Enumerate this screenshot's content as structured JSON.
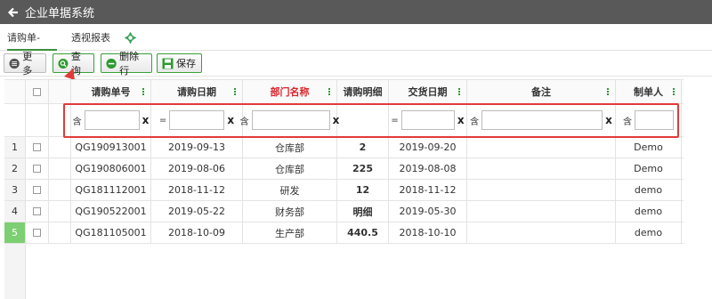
{
  "app": {
    "title": "企业单据系统"
  },
  "tabs": [
    {
      "label": "请购单-ERP"
    },
    {
      "label": "透视报表"
    }
  ],
  "toolbar": {
    "more_label": "更多",
    "query_label": "查询",
    "delete_row_label": "删除行",
    "save_label": "保存"
  },
  "grid": {
    "columns": [
      "请购单号",
      "请购日期",
      "部门名称",
      "请购明细",
      "交货日期",
      "备注",
      "制单人"
    ],
    "filters": {
      "op_contains": "含",
      "op_equals": "=",
      "clear": "x"
    },
    "rows": [
      {
        "num": "1",
        "order_no": "QG190913001",
        "request_date": "2019-09-13",
        "dept": "仓库部",
        "detail": "2",
        "delivery_date": "2019-09-20",
        "remark": "",
        "creator": "Demo"
      },
      {
        "num": "2",
        "order_no": "QG190806001",
        "request_date": "2019-08-06",
        "dept": "仓库部",
        "detail": "225",
        "delivery_date": "2019-08-08",
        "remark": "",
        "creator": "Demo"
      },
      {
        "num": "3",
        "order_no": "QG181112001",
        "request_date": "2018-11-12",
        "dept": "研发",
        "detail": "12",
        "delivery_date": "2018-11-12",
        "remark": "",
        "creator": "demo"
      },
      {
        "num": "4",
        "order_no": "QG190522001",
        "request_date": "2019-05-22",
        "dept": "财务部",
        "detail": "明细",
        "delivery_date": "2019-05-30",
        "remark": "",
        "creator": "demo"
      },
      {
        "num": "5",
        "order_no": "QG181105001",
        "request_date": "2018-10-09",
        "dept": "生产部",
        "detail": "440.5",
        "delivery_date": "2018-10-10",
        "remark": "",
        "creator": "demo"
      }
    ]
  },
  "colors": {
    "accent_green": "#1e9a1e",
    "header_red": "#d9252b",
    "annotation_red": "#e23a3a",
    "titlebar": "#595959"
  },
  "icons": [
    "arrow-left-icon",
    "settings-gear-icon",
    "menu-icon",
    "search-icon",
    "minus-circle-icon",
    "save-icon",
    "more-kebab-icon"
  ]
}
